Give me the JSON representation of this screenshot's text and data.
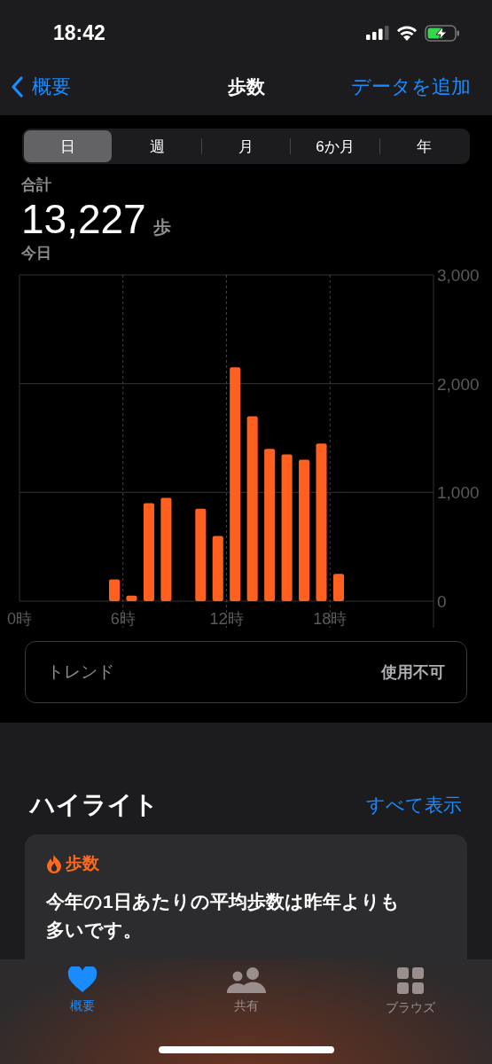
{
  "status_bar": {
    "time": "18:42"
  },
  "nav": {
    "back": "概要",
    "title": "歩数",
    "action": "データを追加"
  },
  "segments": [
    {
      "label": "日",
      "selected": true
    },
    {
      "label": "週",
      "selected": false
    },
    {
      "label": "月",
      "selected": false
    },
    {
      "label": "6か月",
      "selected": false
    },
    {
      "label": "年",
      "selected": false
    }
  ],
  "summary": {
    "label": "合計",
    "value": "13,227",
    "unit": "歩",
    "period": "今日"
  },
  "chart_data": {
    "type": "bar",
    "x": [
      5.5,
      6.5,
      7.5,
      8.5,
      10.5,
      11.5,
      12.5,
      13.5,
      14.5,
      15.5,
      16.5,
      17.5,
      18.5
    ],
    "series": [
      {
        "color": "#ff5f1f",
        "values": [
          200,
          50,
          900,
          950,
          850,
          600,
          2150,
          1700,
          1400,
          1350,
          1300,
          1450,
          250
        ]
      }
    ],
    "grid": true,
    "xlim": [
      0,
      24
    ],
    "ylim": [
      0,
      3000
    ],
    "xticks": [
      {
        "value": 0,
        "label": "0時"
      },
      {
        "value": 6,
        "label": "6時"
      },
      {
        "value": 12,
        "label": "12時"
      },
      {
        "value": 18,
        "label": "18時"
      }
    ],
    "yticks": [
      {
        "value": 0,
        "label": "0"
      },
      {
        "value": 1000,
        "label": "1,000"
      },
      {
        "value": 2000,
        "label": "2,000"
      },
      {
        "value": 3000,
        "label": "3,000"
      }
    ]
  },
  "trend": {
    "label": "トレンド",
    "value": "使用不可"
  },
  "highlights": {
    "title": "ハイライト",
    "link": "すべて表示",
    "card": {
      "category": "歩数",
      "text": "今年の1日あたりの平均歩数は昨年よりも多いです。"
    }
  },
  "tab_bar": [
    {
      "kind": "heart",
      "label": "概要",
      "selected": true
    },
    {
      "kind": "people",
      "label": "共有",
      "selected": false
    },
    {
      "kind": "grid",
      "label": "ブラウズ",
      "selected": false
    }
  ]
}
